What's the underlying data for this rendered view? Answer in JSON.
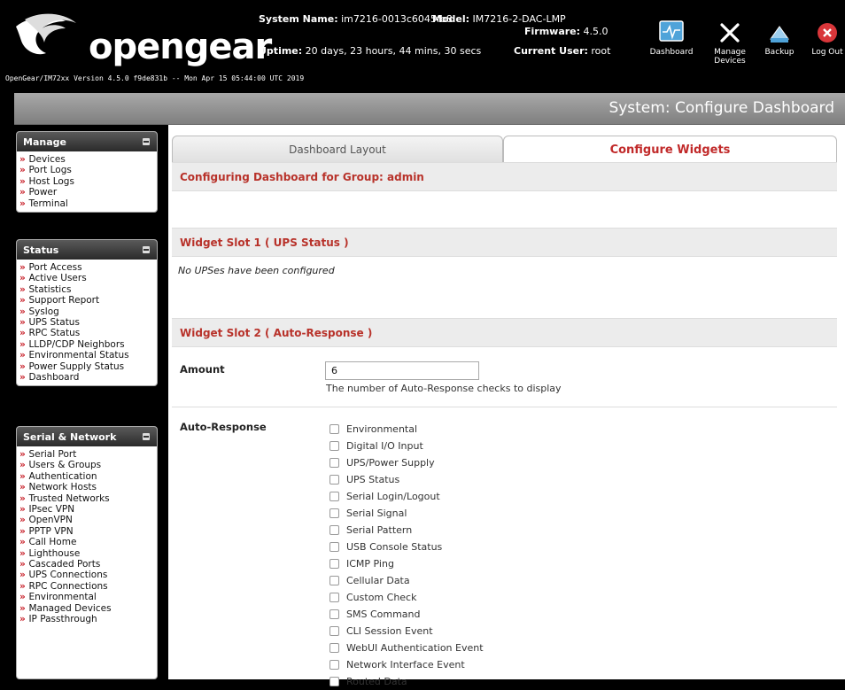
{
  "header": {
    "logo_text": "opengear",
    "version_line": "OpenGear/IM72xx Version 4.5.0 f9de831b -- Mon Apr 15 05:44:00 UTC 2019",
    "system_name_label": "System Name:",
    "system_name": "im7216-0013c6045fb8",
    "model_label": "Model:",
    "model": "IM7216-2-DAC-LMP",
    "firmware_label": "Firmware:",
    "firmware": "4.5.0",
    "uptime_label": "Uptime:",
    "uptime": "20 days, 23 hours, 44 mins, 30 secs",
    "user_label": "Current User:",
    "user": "root",
    "buttons": [
      {
        "label": "Dashboard",
        "icon": "dashboard-icon"
      },
      {
        "label": "Manage Devices",
        "icon": "tools-icon"
      },
      {
        "label": "Backup",
        "icon": "backup-icon"
      },
      {
        "label": "Log Out",
        "icon": "logout-icon"
      }
    ]
  },
  "page_title": "System: Configure Dashboard",
  "sidebar": {
    "manage": {
      "title": "Manage",
      "items": [
        "Devices",
        "Port Logs",
        "Host Logs",
        "Power",
        "Terminal"
      ]
    },
    "status": {
      "title": "Status",
      "items": [
        "Port Access",
        "Active Users",
        "Statistics",
        "Support Report",
        "Syslog",
        "UPS Status",
        "RPC Status",
        "LLDP/CDP Neighbors",
        "Environmental Status",
        "Power Supply Status",
        "Dashboard"
      ]
    },
    "serial": {
      "title": "Serial & Network",
      "items": [
        "Serial Port",
        "Users & Groups",
        "Authentication",
        "Network Hosts",
        "Trusted Networks",
        "IPsec VPN",
        "OpenVPN",
        "PPTP VPN",
        "Call Home",
        "Lighthouse",
        "Cascaded Ports",
        "UPS Connections",
        "RPC Connections",
        "Environmental",
        "Managed Devices",
        "IP Passthrough"
      ]
    }
  },
  "tabs": {
    "layout": "Dashboard Layout",
    "widgets": "Configure Widgets"
  },
  "group_heading": "Configuring Dashboard for Group: admin",
  "slot1": {
    "heading": "Widget Slot 1 ( UPS Status )",
    "note": "No UPSes have been configured"
  },
  "slot2": {
    "heading": "Widget Slot 2 ( Auto-Response )",
    "amount_label": "Amount",
    "amount_value": "6",
    "amount_hint": "The number of Auto-Response checks to display",
    "autoresponse_label": "Auto-Response",
    "checks": [
      "Environmental",
      "Digital I/O Input",
      "UPS/Power Supply",
      "UPS Status",
      "Serial Login/Logout",
      "Serial Signal",
      "Serial Pattern",
      "USB Console Status",
      "ICMP Ping",
      "Cellular Data",
      "Custom Check",
      "SMS Command",
      "CLI Session Event",
      "WebUI Authentication Event",
      "Network Interface Event",
      "Routed Data"
    ]
  }
}
